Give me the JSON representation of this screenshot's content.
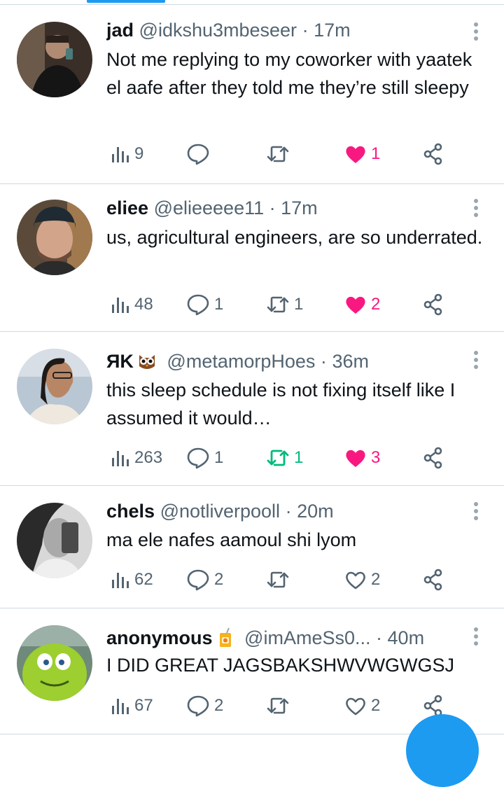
{
  "tweets": [
    {
      "name": "jad",
      "handle": "@idkshu3mbeseer",
      "dot": "·",
      "time": "17m",
      "text": "Not me replying to my coworker with yaatek el aafe after they told me they’re still sleepy",
      "views": "9",
      "replies": "",
      "retweets": "",
      "likes": "1",
      "liked": true,
      "retweeted": false
    },
    {
      "name": "eliee",
      "handle": "@elieeeee11",
      "dot": "·",
      "time": "17m",
      "text": "us, agricultural engineers, are so underrated.",
      "views": "48",
      "replies": "1",
      "retweets": "1",
      "likes": "2",
      "liked": true,
      "retweeted": false
    },
    {
      "name": "ЯK",
      "name_emoji": "owl",
      "handle": "@metamorpHoes",
      "dot": "·",
      "time": "36m",
      "text": "this sleep schedule is not fixing itself like I assumed it would…",
      "views": "263",
      "replies": "1",
      "retweets": "1",
      "likes": "3",
      "liked": true,
      "retweeted": true
    },
    {
      "name": "chels",
      "handle": "@notliverpooll",
      "dot": "·",
      "time": "20m",
      "text": "ma ele nafes aamoul shi lyom",
      "views": "62",
      "replies": "2",
      "retweets": "",
      "likes": "2",
      "liked": false,
      "retweeted": false
    },
    {
      "name": "anonymous",
      "name_emoji": "juice-box",
      "handle": "@imAmeSs0...",
      "dot": "·",
      "time": "40m",
      "text": "I DID GREAT JAGSBAKSHWVWGWGSJ",
      "views": "67",
      "replies": "2",
      "retweets": "",
      "likes": "2",
      "liked": false,
      "retweeted": false
    }
  ],
  "icons": {
    "views": "views-chart-icon",
    "reply": "reply-bubble-icon",
    "retweet": "retweet-arrows-icon",
    "like": "heart-icon",
    "share": "share-nodes-icon",
    "more": "more-vertical-icon"
  },
  "colors": {
    "accent": "#1d9bf0",
    "like": "#f91880",
    "retweet": "#00ba7c",
    "muted": "#536471",
    "text": "#0f1419",
    "divider": "#cfd9de"
  }
}
